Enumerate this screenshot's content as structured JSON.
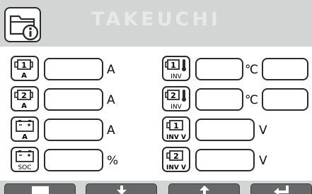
{
  "header": {
    "brand": "TAKEUCHI",
    "info_icon": "folder-info-icon"
  },
  "left_column": [
    {
      "icon": "motor-1-icon",
      "icon_label": "A",
      "badge": "1",
      "unit": "A"
    },
    {
      "icon": "motor-2-icon",
      "icon_label": "A",
      "badge": "2",
      "unit": "A"
    },
    {
      "icon": "battery-current-icon",
      "icon_label": "A",
      "unit": "A"
    },
    {
      "icon": "battery-soc-icon",
      "icon_label": "SOC",
      "unit": "%"
    }
  ],
  "right_column": [
    {
      "icon": "inverter-1-temp-icon",
      "icon_label": "INV",
      "badge": "1",
      "unit": "℃"
    },
    {
      "icon": "inverter-2-temp-icon",
      "icon_label": "INV",
      "badge": "2",
      "unit": "℃"
    },
    {
      "icon": "inverter-1-voltage-icon",
      "icon_label": "INV V",
      "badge": "1",
      "unit": "V"
    },
    {
      "icon": "inverter-2-voltage-icon",
      "icon_label": "INV V",
      "badge": "2",
      "unit": "V"
    }
  ],
  "softkeys": [
    {
      "name": "screen-icon"
    },
    {
      "name": "arrow-down-icon"
    },
    {
      "name": "arrow-up-icon"
    },
    {
      "name": "enter-icon"
    }
  ],
  "colors": {
    "header_bg": "#d3d4d4",
    "softkey_bg": "#66686a",
    "border": "#2b2b2b"
  }
}
